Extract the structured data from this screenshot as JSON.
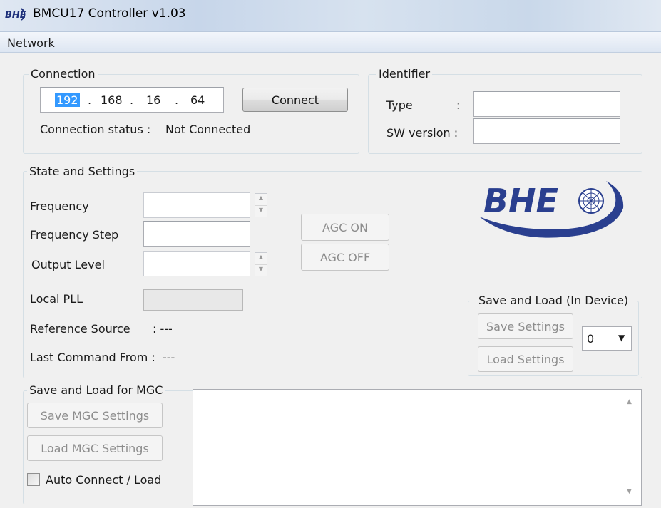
{
  "window": {
    "title": "BMCU17 Controller v1.03",
    "icon": "bhe-app-icon"
  },
  "menu": {
    "items": [
      "Network"
    ]
  },
  "connection": {
    "group_label": "Connection",
    "ip": [
      "192",
      "168",
      "16",
      "64"
    ],
    "ip_dot": ".",
    "connect_label": "Connect",
    "status_label": "Connection status :",
    "status_value": "Not Connected"
  },
  "identifier": {
    "group_label": "Identifier",
    "type_label": "Type",
    "type_colon": ":",
    "type_value": "",
    "sw_label": "SW version :",
    "sw_value": ""
  },
  "state": {
    "group_label": "State and Settings",
    "frequency_label": "Frequency",
    "frequency_value": "",
    "freq_step_label": "Frequency Step",
    "freq_step_value": "",
    "output_level_label": "Output Level",
    "output_level_value": "",
    "agc_on_label": "AGC ON",
    "agc_off_label": "AGC OFF",
    "local_pll_label": "Local PLL",
    "reference_label": "Reference Source",
    "reference_value": ": ---",
    "last_cmd_label": "Last Command From :",
    "last_cmd_value": "---",
    "logo_text": "BHE"
  },
  "device_save": {
    "group_label": "Save and Load (In Device)",
    "save_label": "Save Settings",
    "load_label": "Load Settings",
    "slot_value": "0"
  },
  "mgc": {
    "group_label": "Save and Load for MGC",
    "save_label": "Save MGC Settings",
    "load_label": "Load MGC Settings",
    "auto_label": "Auto Connect / Load",
    "log_text": ""
  },
  "colors": {
    "logo_blue": "#2a3f8f",
    "selection": "#3399ff"
  }
}
